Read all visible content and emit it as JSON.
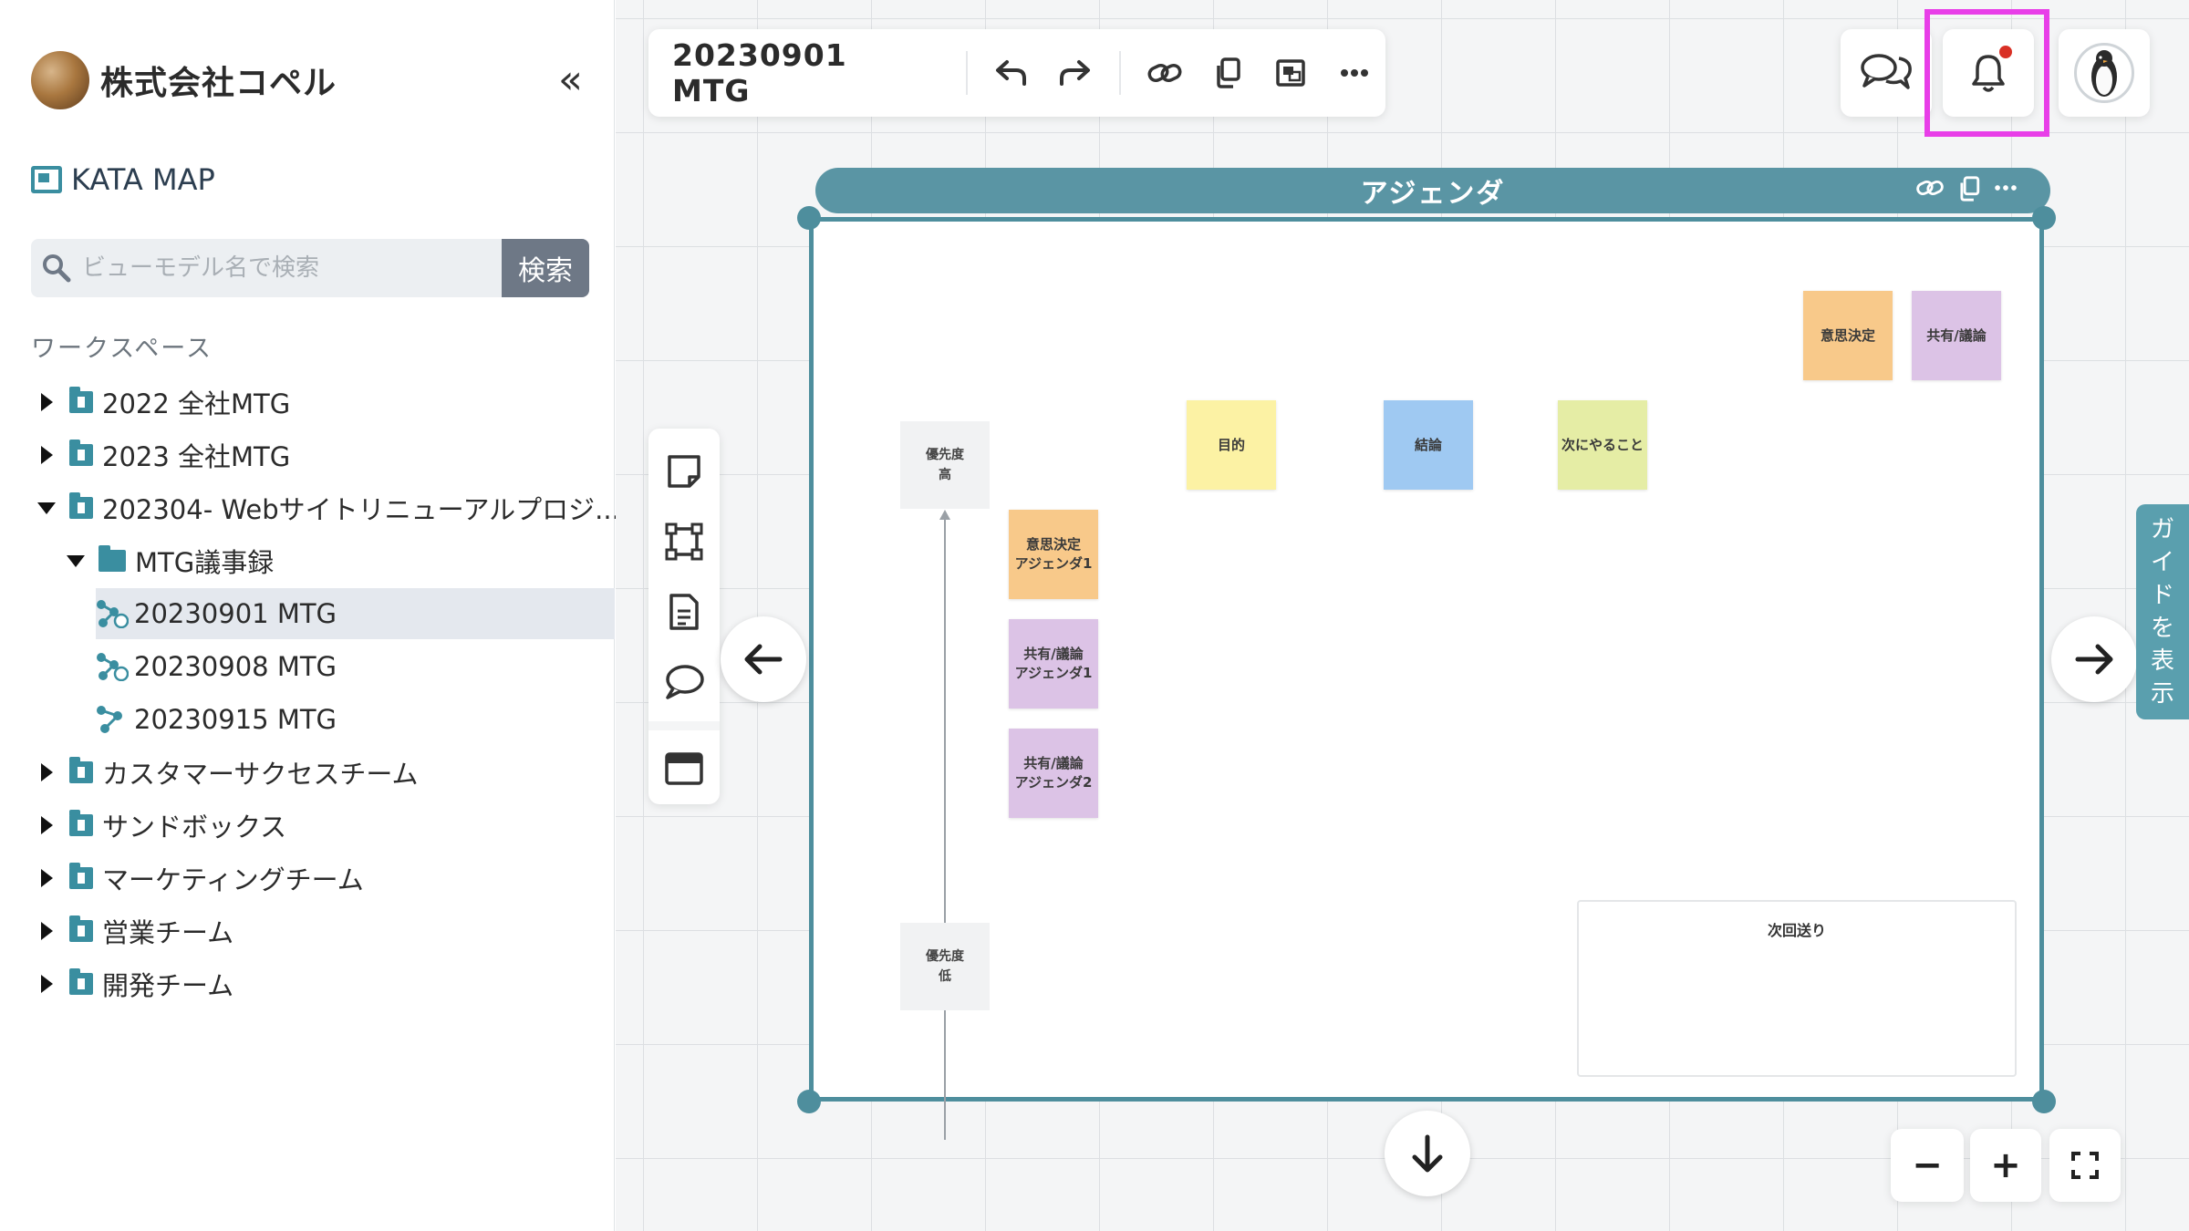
{
  "sidebar": {
    "org_name": "株式会社コペル",
    "collapse_icon": "double-chevron-left-icon",
    "app_name": "KATA MAP",
    "search": {
      "placeholder": "ビューモデル名で検索",
      "value": "",
      "button_label": "検索"
    },
    "workspace_heading": "ワークスペース",
    "tree": [
      {
        "label": "2022 全社MTG",
        "type": "workspace",
        "expanded": false
      },
      {
        "label": "2023 全社MTG",
        "type": "workspace",
        "expanded": false
      },
      {
        "label": "202304- Webサイトリニューアルプロジ...",
        "type": "workspace",
        "expanded": true
      },
      {
        "label": "MTG議事録",
        "type": "folder",
        "expanded": true
      },
      {
        "label": "20230901 MTG",
        "type": "map",
        "selected": true
      },
      {
        "label": "20230908 MTG",
        "type": "map"
      },
      {
        "label": "20230915 MTG",
        "type": "map"
      },
      {
        "label": "カスタマーサクセスチーム",
        "type": "workspace",
        "expanded": false
      },
      {
        "label": "サンドボックス",
        "type": "workspace",
        "expanded": false
      },
      {
        "label": "マーケティングチーム",
        "type": "workspace",
        "expanded": false
      },
      {
        "label": "営業チーム",
        "type": "workspace",
        "expanded": false
      },
      {
        "label": "開発チーム",
        "type": "workspace",
        "expanded": false
      }
    ]
  },
  "toolbar": {
    "title": "20230901 MTG",
    "icons": [
      "undo-icon",
      "redo-icon",
      "link-icon",
      "copy-icon",
      "image-icon",
      "more-icon"
    ]
  },
  "topbar": {
    "icons": [
      "chat-icon",
      "bell-icon",
      "user-avatar"
    ],
    "notification_unread": true
  },
  "frame": {
    "title": "アジェンダ",
    "stickies": {
      "decision": "意思決定",
      "share_discuss": "共有/議論",
      "purpose": "目的",
      "conclusion": "結論",
      "next_action": "次にやること",
      "agenda_decision_1": "意思決定\nアジェンダ1",
      "agenda_share_1": "共有/議論\nアジェンダ1",
      "agenda_share_2": "共有/議論\nアジェンダ2"
    },
    "priority_high": "優先度\n高",
    "priority_low": "優先度\n低",
    "carry_over_title": "次回送り"
  },
  "guide_tab": {
    "chars": [
      "ガ",
      "イ",
      "ド",
      "を",
      "表",
      "示"
    ]
  },
  "zoom": {
    "minus": "−",
    "plus": "+"
  },
  "colors": {
    "accent": "#4e8e9d",
    "orange": "#f8c98a",
    "purple": "#dcc3e6",
    "yellow": "#fcf2a4",
    "blue": "#9fc9f2",
    "lime": "#e5eda5",
    "highlight": "#e83ee8",
    "notif_dot": "#d93025"
  }
}
